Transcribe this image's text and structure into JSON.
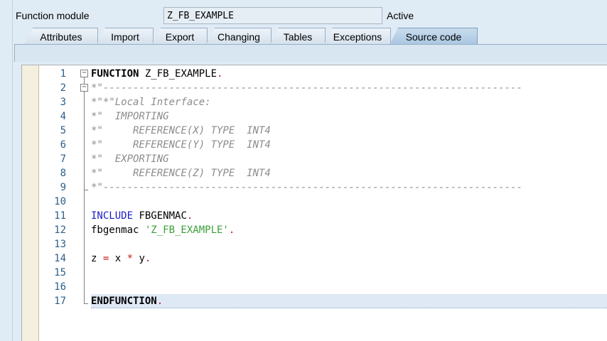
{
  "header": {
    "function_module_label": "Function module",
    "function_module_value": "Z_FB_EXAMPLE",
    "status": "Active"
  },
  "tabs": [
    {
      "label": "Attributes",
      "active": false
    },
    {
      "label": "Import",
      "active": false
    },
    {
      "label": "Export",
      "active": false
    },
    {
      "label": "Changing",
      "active": false
    },
    {
      "label": "Tables",
      "active": false
    },
    {
      "label": "Exceptions",
      "active": false
    },
    {
      "label": "Source code",
      "active": true
    }
  ],
  "editor": {
    "line_numbers": [
      "1",
      "2",
      "3",
      "4",
      "5",
      "6",
      "7",
      "8",
      "9",
      "10",
      "11",
      "12",
      "13",
      "14",
      "15",
      "16",
      "17"
    ],
    "lines": [
      [
        {
          "t": "FUNCTION",
          "c": "kw"
        },
        {
          "t": " Z_FB_EXAMPLE",
          "c": "plain"
        },
        {
          "t": ".",
          "c": "op"
        }
      ],
      [
        {
          "t": "*\"----------------------------------------------------------------------",
          "c": "cm"
        }
      ],
      [
        {
          "t": "*\"*\"Local Interface:",
          "c": "cm"
        }
      ],
      [
        {
          "t": "*\"  IMPORTING",
          "c": "cm"
        }
      ],
      [
        {
          "t": "*\"     REFERENCE(X) TYPE  INT4",
          "c": "cm"
        }
      ],
      [
        {
          "t": "*\"     REFERENCE(Y) TYPE  INT4",
          "c": "cm"
        }
      ],
      [
        {
          "t": "*\"  EXPORTING",
          "c": "cm"
        }
      ],
      [
        {
          "t": "*\"     REFERENCE(Z) TYPE  INT4",
          "c": "cm"
        }
      ],
      [
        {
          "t": "*\"----------------------------------------------------------------------",
          "c": "cm"
        }
      ],
      [],
      [
        {
          "t": "INCLUDE",
          "c": "kw-blue"
        },
        {
          "t": " FBGENMAC",
          "c": "plain"
        },
        {
          "t": ".",
          "c": "op"
        }
      ],
      [
        {
          "t": "fbgenmac ",
          "c": "plain"
        },
        {
          "t": "'Z_FB_EXAMPLE'",
          "c": "str"
        },
        {
          "t": ".",
          "c": "op"
        }
      ],
      [],
      [
        {
          "t": "z ",
          "c": "plain"
        },
        {
          "t": "=",
          "c": "op"
        },
        {
          "t": " x ",
          "c": "plain"
        },
        {
          "t": "*",
          "c": "op"
        },
        {
          "t": " y",
          "c": "plain"
        },
        {
          "t": ".",
          "c": "op"
        }
      ],
      [],
      [],
      [
        {
          "t": "ENDFUNCTION",
          "c": "kw"
        },
        {
          "t": ".",
          "c": "op"
        }
      ]
    ],
    "current_line": 17
  }
}
